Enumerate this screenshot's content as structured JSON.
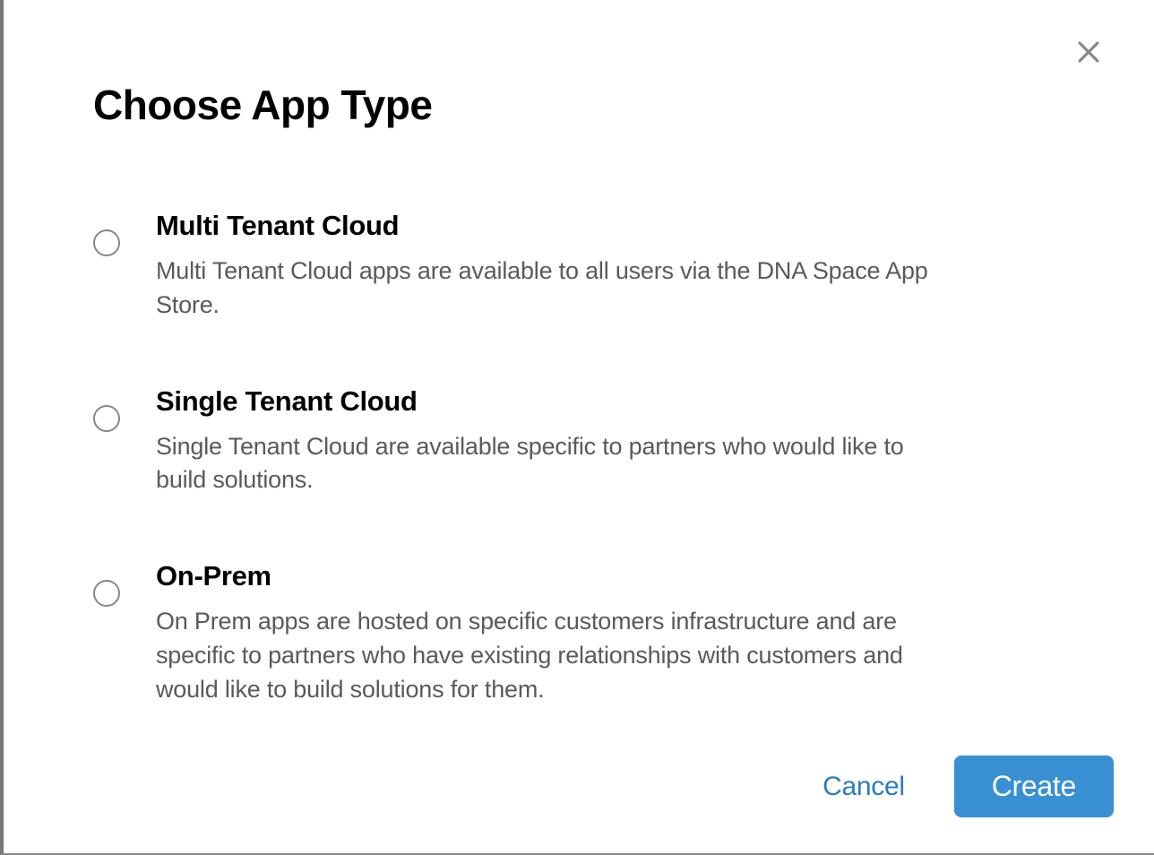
{
  "modal": {
    "title": "Choose App Type",
    "options": [
      {
        "title": "Multi Tenant Cloud",
        "description": "Multi Tenant Cloud apps are available to all users via the DNA Space App Store."
      },
      {
        "title": "Single Tenant Cloud",
        "description": "Single Tenant Cloud are available specific to partners who would like to build solutions."
      },
      {
        "title": "On-Prem",
        "description": "On Prem apps are hosted on specific customers infrastructure and are specific to partners who have existing relationships with customers and would like to build solutions for them."
      }
    ],
    "buttons": {
      "cancel": "Cancel",
      "create": "Create"
    }
  }
}
